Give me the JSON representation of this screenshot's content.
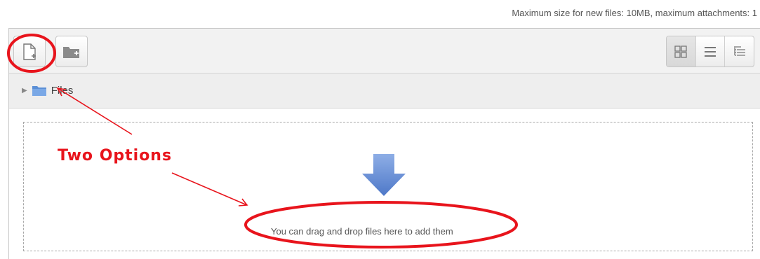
{
  "limits": {
    "text": "Maximum size for new files: 10MB, maximum attachments: 1"
  },
  "toolbar": {
    "add_file_icon": "add-file-icon",
    "create_folder_icon": "create-folder-icon",
    "view_modes": [
      "icons-view-icon",
      "list-view-icon",
      "tree-view-icon"
    ]
  },
  "path": {
    "folder_label": "Files"
  },
  "dropzone": {
    "message": "You can drag and drop files here to add them"
  },
  "annotation": {
    "label": "Two Options",
    "color": "#e8141c"
  }
}
